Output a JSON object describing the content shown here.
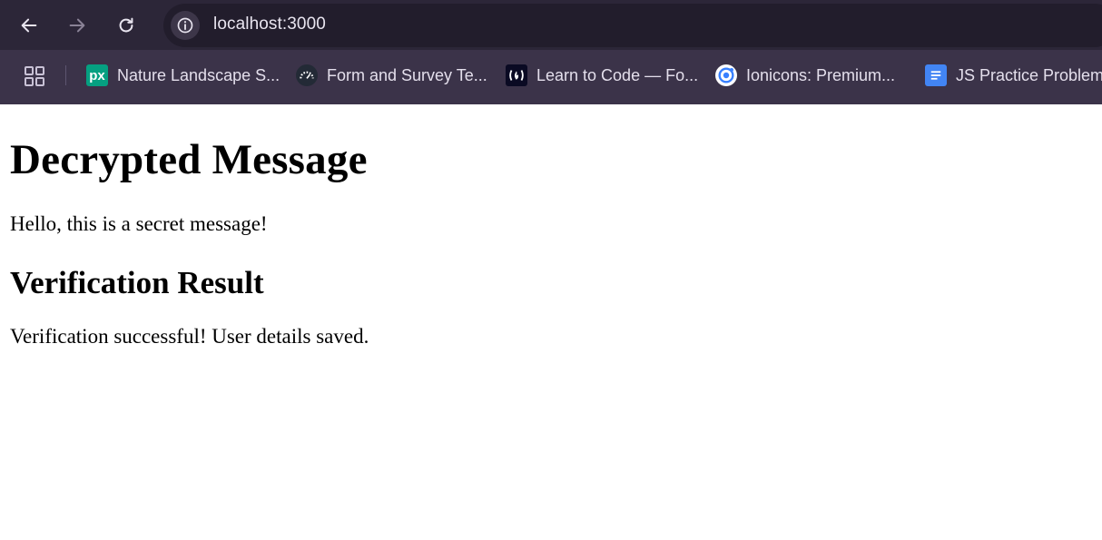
{
  "browser": {
    "url": "localhost:3000",
    "bookmarks": [
      {
        "label": "Nature Landscape S...",
        "icon": "pexels-icon"
      },
      {
        "label": "Form and Survey Te...",
        "icon": "speedometer-icon"
      },
      {
        "label": "Learn to Code — Fo...",
        "icon": "freecodecamp-icon"
      },
      {
        "label": "Ionicons: Premium...",
        "icon": "ionicons-icon"
      },
      {
        "label": "JS Practice Problem...",
        "icon": "docs-icon"
      }
    ],
    "colors": {
      "toolbar_bg": "#2c2638",
      "bookmarks_bg": "#3b3349",
      "omnibox_bg": "#221d2c"
    }
  },
  "page": {
    "title": "Decrypted Message",
    "message": "Hello, this is a secret message!",
    "verification_heading": "Verification Result",
    "verification_text": "Verification successful! User details saved."
  }
}
